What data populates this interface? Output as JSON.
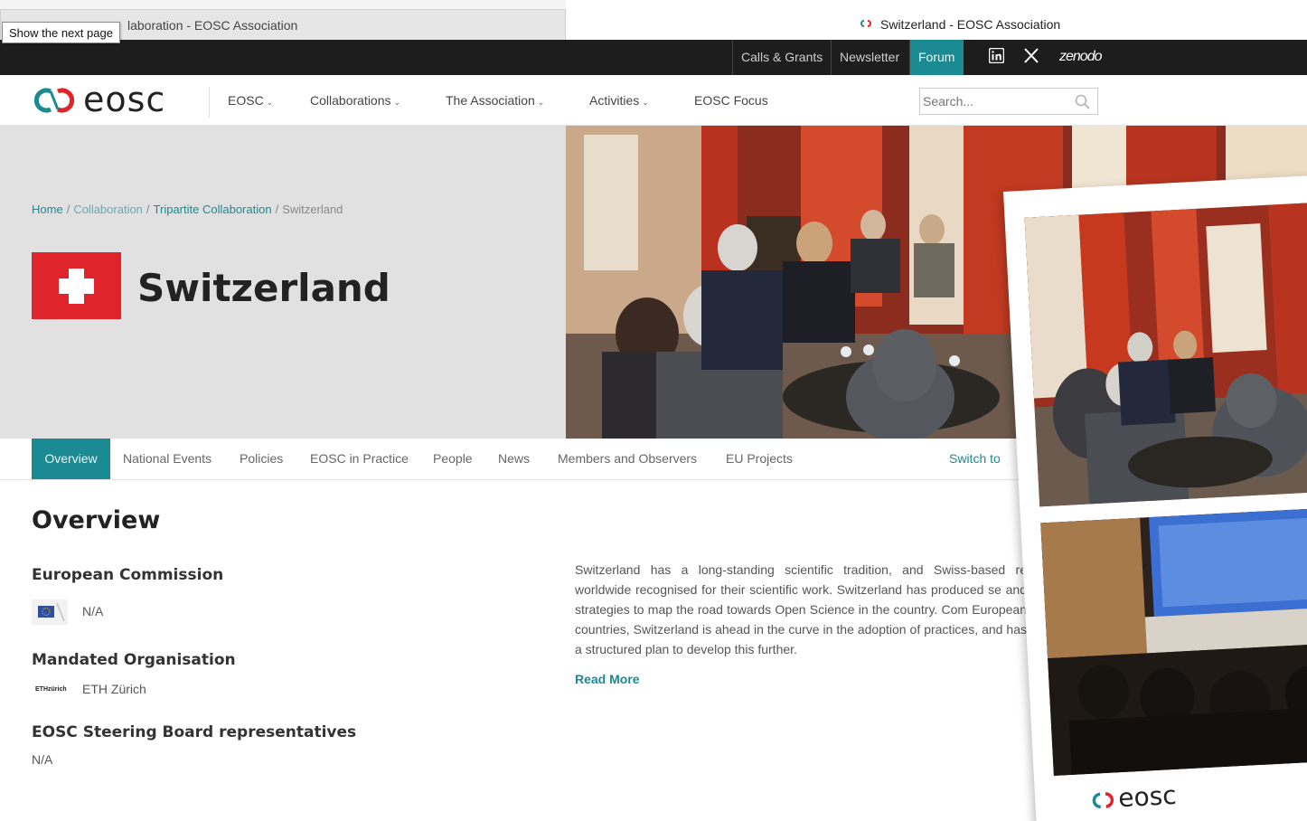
{
  "browser": {
    "inactive_tab_title": "laboration - EOSC Association",
    "active_tab_title": "Switzerland - EOSC Association",
    "tooltip": "Show the next page"
  },
  "topbar": {
    "links": [
      "Calls & Grants",
      "Newsletter",
      "Forum"
    ],
    "icons": [
      "linkedin-icon",
      "x-icon"
    ],
    "zenodo_label": "zenodo"
  },
  "nav": {
    "logo_text": "eosc",
    "items": [
      "EOSC",
      "Collaborations",
      "The Association",
      "Activities",
      "EOSC Focus"
    ],
    "search_placeholder": "Search..."
  },
  "breadcrumb": {
    "items": [
      "Home",
      "Collaboration",
      "Tripartite Collaboration"
    ],
    "current": "Switzerland",
    "separator": "/"
  },
  "hero": {
    "title": "Switzerland",
    "flag_color": "#e0242b"
  },
  "subtabs": {
    "items": [
      "Overview",
      "National Events",
      "Policies",
      "EOSC in Practice",
      "People",
      "News",
      "Members and Observers",
      "EU Projects"
    ],
    "active": "Overview",
    "switch_label": "Switch to"
  },
  "overview": {
    "title": "Overview",
    "fields": [
      {
        "heading": "European Commission",
        "value": "N/A"
      },
      {
        "heading": "Mandated Organisation",
        "value": "ETH Zürich"
      },
      {
        "heading": "EOSC Steering Board representatives",
        "value": "N/A"
      }
    ],
    "eth_logo_text": "ETHzürich",
    "summary": "Switzerland has a long-standing scientific tradition, and Swiss-based re worldwide recognised for their scientific work. Switzerland has produced se and strategies to map the road towards Open Science in the country. Com European countries, Switzerland is ahead in the curve in the adoption of practices, and has a structured plan to develop this further.",
    "read_more": "Read More"
  },
  "overlay": {
    "logo_text": "eosc"
  },
  "colors": {
    "accent": "#1b8a92",
    "topbar": "#1d1d1d",
    "hero_grey": "#e1e1e1",
    "swiss_red": "#e0242b"
  }
}
